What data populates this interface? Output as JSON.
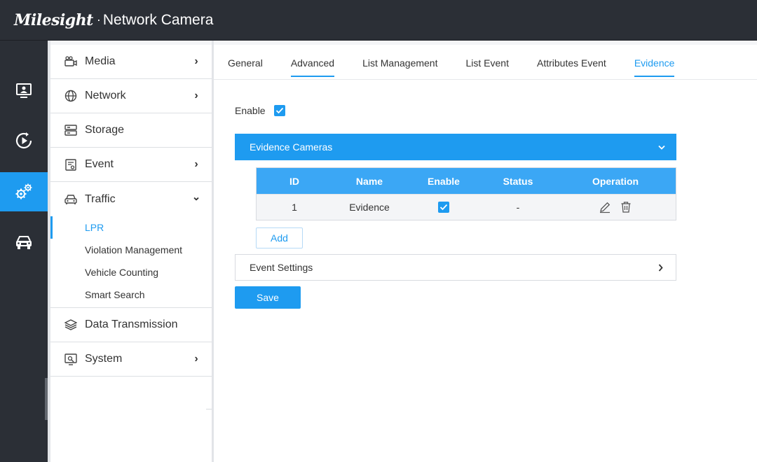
{
  "header": {
    "brand": "Milesight",
    "separator": "·",
    "product": "Network Camera"
  },
  "rail": [
    {
      "icon": "live-view-icon",
      "active": false
    },
    {
      "icon": "playback-icon",
      "active": false
    },
    {
      "icon": "settings-icon",
      "active": true
    },
    {
      "icon": "vehicle-icon",
      "active": false
    }
  ],
  "sidebar": {
    "items": [
      {
        "label": "Media",
        "icon": "media-icon",
        "chevron": "›"
      },
      {
        "label": "Network",
        "icon": "globe-icon",
        "chevron": "›"
      },
      {
        "label": "Storage",
        "icon": "storage-icon",
        "chevron": ""
      },
      {
        "label": "Event",
        "icon": "event-icon",
        "chevron": "›"
      },
      {
        "label": "Traffic",
        "icon": "car-icon",
        "chevron": "⌄"
      },
      {
        "label": "Data Transmission",
        "icon": "layers-icon",
        "chevron": ""
      },
      {
        "label": "System",
        "icon": "system-icon",
        "chevron": "›"
      }
    ],
    "traffic_sub": [
      "LPR",
      "Violation Management",
      "Vehicle Counting",
      "Smart Search"
    ],
    "active_sub": "LPR"
  },
  "tabs": [
    "General",
    "Advanced",
    "List Management",
    "List Event",
    "Attributes Event",
    "Evidence"
  ],
  "active_tab": "Evidence",
  "evidence": {
    "enable_label": "Enable",
    "enable_checked": true,
    "cameras_panel_title": "Evidence Cameras",
    "table": {
      "headers": [
        "ID",
        "Name",
        "Enable",
        "Status",
        "Operation"
      ],
      "rows": [
        {
          "id": "1",
          "name": "Evidence",
          "enable": true,
          "status": "-"
        }
      ]
    },
    "add_label": "Add",
    "event_settings_title": "Event Settings",
    "save_label": "Save"
  },
  "colors": {
    "accent": "#1e9bf0",
    "topbar": "#2b2f36",
    "table_header": "#3ba7f5"
  }
}
